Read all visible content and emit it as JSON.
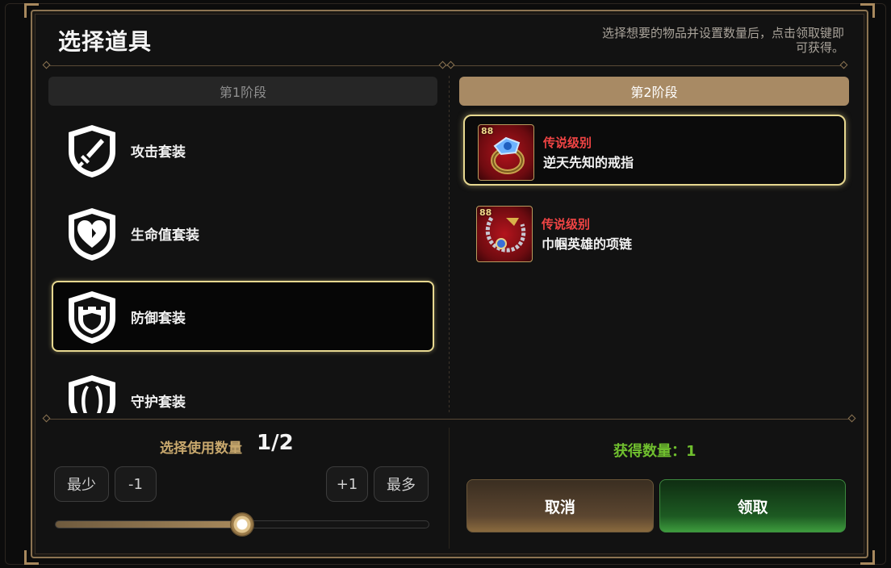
{
  "title": "选择道具",
  "hint": "选择想要的物品并设置数量后，点击领取键即可获得。",
  "stages": {
    "stage1_label": "第1阶段",
    "stage2_label": "第2阶段"
  },
  "sets": [
    {
      "label": "攻击套装",
      "icon": "sword-shield-icon",
      "selected": false
    },
    {
      "label": "生命值套装",
      "icon": "heart-shield-icon",
      "selected": false
    },
    {
      "label": "防御套装",
      "icon": "defense-shield-icon",
      "selected": true
    },
    {
      "label": "守护套装",
      "icon": "guard-shield-icon",
      "selected": false
    }
  ],
  "items": [
    {
      "level": "88",
      "grade": "传说级别",
      "name": "逆天先知的戒指",
      "icon": "ring-icon",
      "selected": true
    },
    {
      "level": "88",
      "grade": "传说级别",
      "name": "巾帼英雄的项链",
      "icon": "necklace-icon",
      "selected": false
    }
  ],
  "quantity": {
    "label": "选择使用数量",
    "value": "1/2",
    "min_label": "最少",
    "minus_label": "-1",
    "plus_label": "+1",
    "max_label": "最多",
    "slider_fraction": 0.5
  },
  "gain": {
    "label": "获得数量：1"
  },
  "buttons": {
    "cancel_label": "取消",
    "confirm_label": "领取"
  },
  "colors": {
    "accent_gold": "#a88a64",
    "selected_border": "#e7d890",
    "legend_red": "#f04444",
    "gain_green": "#6fbe2e"
  }
}
